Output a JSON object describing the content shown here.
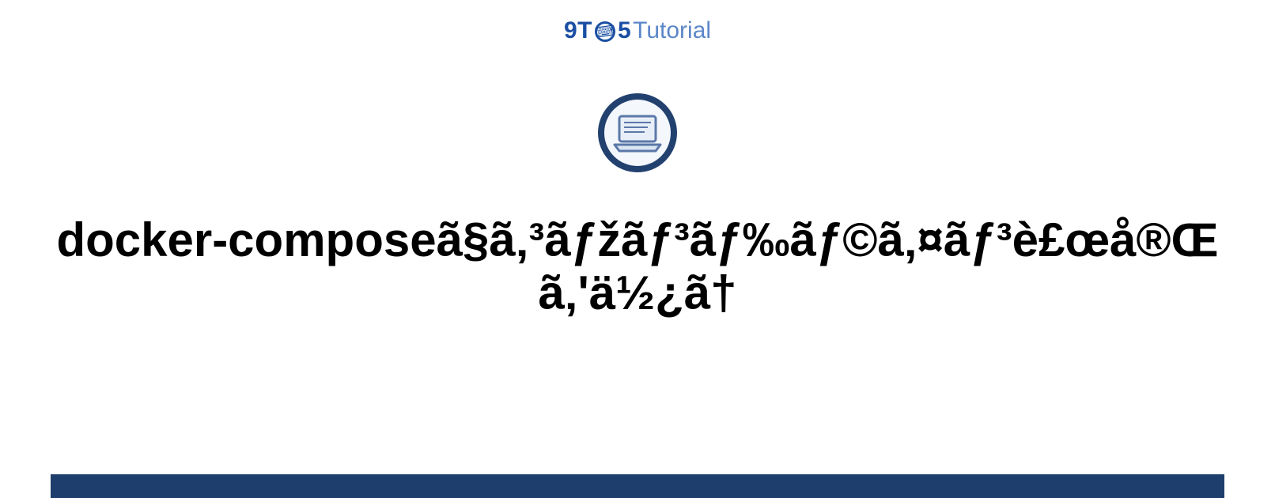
{
  "logo": {
    "part1": "9T",
    "part2": "5",
    "part3": "Tutorial",
    "icon_glyph": "⌨"
  },
  "icon_name": "laptop-icon",
  "title": "docker-composeã§ã‚³ãƒžãƒ³ãƒ‰ãƒ©ã‚¤ãƒ³è£œå®Œã‚'ä½¿ã†",
  "accent_color": "#1e3f6e"
}
